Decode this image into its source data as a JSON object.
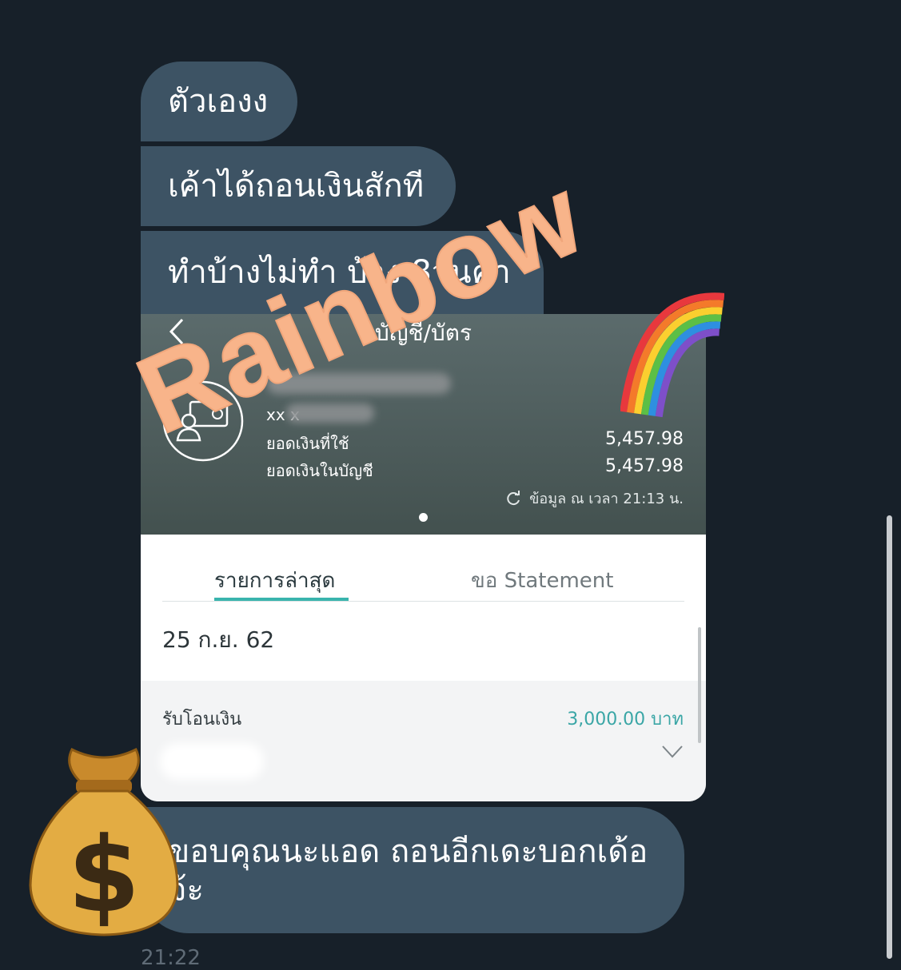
{
  "messages": {
    "m1": "ตัวเองง",
    "m2": "เค้าได้ถอนเงินสักที",
    "m3": "ทำบ้างไม่ทำ บ้าง 8วันค้า",
    "m4": "ขอบคุณนะแอด ถอนอีกเดะบอกเด้อจ้ะ",
    "time": "21:22"
  },
  "screenshot": {
    "title": "บัญชี/บัตร",
    "account_line": "xx                x",
    "available_label": "ยอดเงินที่ใช้",
    "balance_label": "ยอดเงินในบัญชี",
    "available_amount": "5,457.98",
    "balance_amount": "5,457.98",
    "updated": "ข้อมูล ณ เวลา 21:13 น.",
    "tab_recent": "รายการล่าสุด",
    "tab_statement": "ขอ Statement",
    "date": "25 ก.ย. 62",
    "tx_label": "รับโอนเงิน",
    "tx_amount": "3,000.00 บาท"
  },
  "watermark": "Rainbow",
  "icons": {
    "rainbow": "rainbow-emoji-icon",
    "money_bag": "money-bag-emoji-icon"
  },
  "colors": {
    "background": "#172029",
    "bubble": "#3d5364",
    "accent": "#39b4ad",
    "watermark": "#f8b48a"
  }
}
